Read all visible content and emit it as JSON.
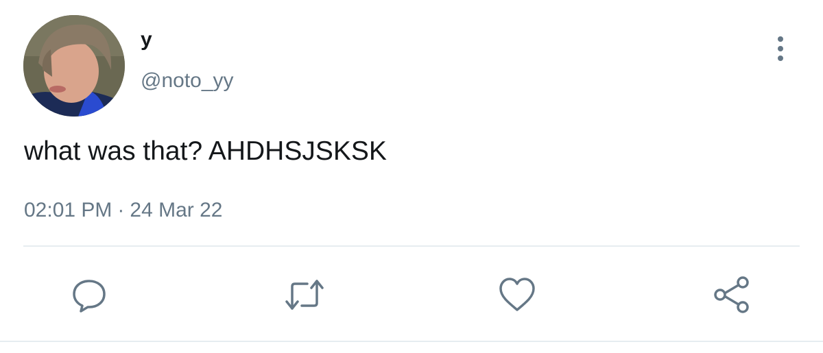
{
  "tweet": {
    "author": {
      "display_name": "y",
      "handle": "@noto_yy",
      "avatar_icon": "avatar-photo"
    },
    "text": "what was that? AHDHSJSKSK",
    "time": "02:01 PM",
    "separator": "·",
    "date": "24 Mar 22",
    "more_icon": "more-vertical-icon"
  },
  "actions": [
    {
      "name": "reply",
      "icon": "speech-bubble-icon"
    },
    {
      "name": "retweet",
      "icon": "retweet-arrows-icon"
    },
    {
      "name": "like",
      "icon": "heart-icon"
    },
    {
      "name": "share",
      "icon": "share-nodes-icon"
    }
  ],
  "colors": {
    "text_primary": "#14171a",
    "text_secondary": "#657786",
    "divider": "#e6ecf0",
    "icon": "#657786"
  }
}
